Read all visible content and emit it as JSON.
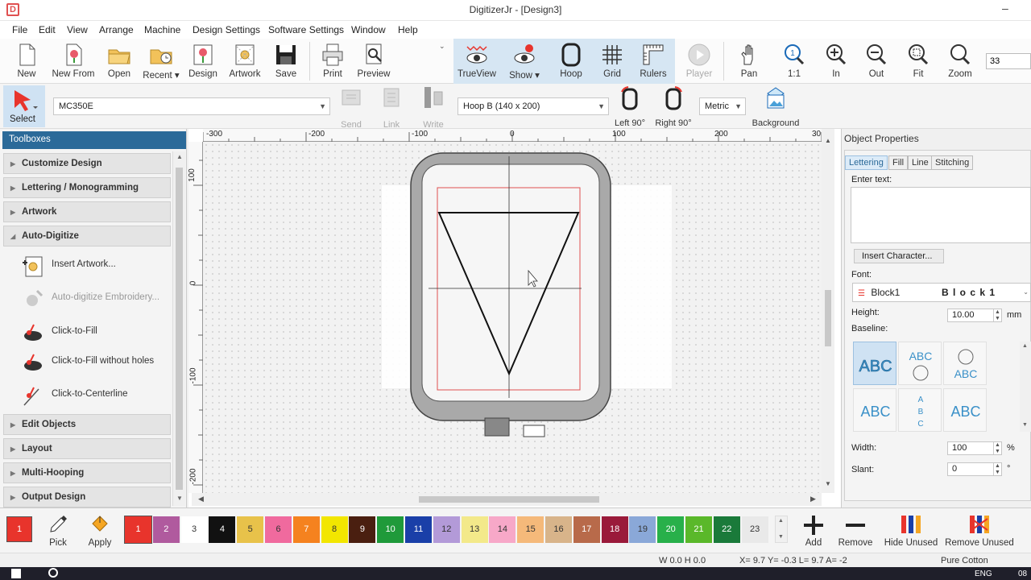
{
  "window": {
    "app_icon": "D",
    "title": "DigitizerJr - [Design3]",
    "minimize": "–"
  },
  "menu": [
    "File",
    "Edit",
    "View",
    "Arrange",
    "Machine",
    "Design Settings",
    "Software Settings",
    "Window",
    "Help"
  ],
  "toolbar1": {
    "new": "New",
    "new_from": "New From",
    "open": "Open",
    "recent": "Recent",
    "design": "Design",
    "artwork": "Artwork",
    "save": "Save",
    "print": "Print",
    "preview": "Preview",
    "trueview": "TrueView",
    "show": "Show",
    "hoop": "Hoop",
    "grid": "Grid",
    "rulers": "Rulers",
    "player": "Player",
    "pan": "Pan",
    "one_to_one": "1:1",
    "in": "In",
    "out": "Out",
    "fit": "Fit",
    "zoom": "Zoom",
    "zoom_value": "33"
  },
  "toolbar2": {
    "select": "Select",
    "machine": "MC350E",
    "send": "Send",
    "link": "Link",
    "write": "Write",
    "hoop_size": "Hoop B (140 x 200)",
    "left90": "Left 90°",
    "right90": "Right 90°",
    "units": "Metric",
    "background": "Background"
  },
  "toolboxes": {
    "header": "Toolboxes",
    "sections": {
      "customize": "Customize Design",
      "lettering": "Lettering / Monogramming",
      "artwork": "Artwork",
      "autodigitize": "Auto-Digitize",
      "edit_objects": "Edit Objects",
      "layout": "Layout",
      "multi_hooping": "Multi-Hooping",
      "output": "Output Design"
    },
    "tools": {
      "insert_artwork": "Insert Artwork...",
      "auto_embroidery": "Auto-digitize Embroidery...",
      "click_fill": "Click-to-Fill",
      "click_fill_no_holes": "Click-to-Fill without holes",
      "click_centerline": "Click-to-Centerline"
    }
  },
  "ruler": {
    "top": [
      "-300",
      "-200",
      "-100",
      "0",
      "100",
      "200",
      "30"
    ],
    "left": [
      "100",
      "0",
      "-100",
      "-200"
    ]
  },
  "object_properties": {
    "title": "Object Properties",
    "tabs": [
      "Lettering",
      "Fill",
      "Line",
      "Stitching"
    ],
    "enter_text_label": "Enter text:",
    "enter_text_value": "",
    "insert_character": "Insert Character...",
    "font_label": "Font:",
    "font_name": "Block1",
    "font_preview": "B l o c k 1",
    "height_label": "Height:",
    "height_value": "10.00",
    "height_unit": "mm",
    "baseline_label": "Baseline:",
    "baseline_text": "ABC",
    "width_label": "Width:",
    "width_value": "100",
    "width_unit": "%",
    "slant_label": "Slant:",
    "slant_value": "0",
    "slant_unit": "°"
  },
  "palette": {
    "current": "1",
    "pick": "Pick",
    "apply": "Apply",
    "add": "Add",
    "remove": "Remove",
    "hide_unused": "Hide Unused",
    "remove_unused": "Remove Unused",
    "colors": [
      {
        "n": "1",
        "c": "#e8342c"
      },
      {
        "n": "2",
        "c": "#b05a9e"
      },
      {
        "n": "3",
        "c": "#ffffff"
      },
      {
        "n": "4",
        "c": "#111111"
      },
      {
        "n": "5",
        "c": "#e8c24a"
      },
      {
        "n": "6",
        "c": "#f06a9e"
      },
      {
        "n": "7",
        "c": "#f5821f"
      },
      {
        "n": "8",
        "c": "#f2e600"
      },
      {
        "n": "9",
        "c": "#4a1f10"
      },
      {
        "n": "10",
        "c": "#1f9a3a"
      },
      {
        "n": "11",
        "c": "#1a3fa8"
      },
      {
        "n": "12",
        "c": "#b39ad8"
      },
      {
        "n": "13",
        "c": "#f3e98a"
      },
      {
        "n": "14",
        "c": "#f7a8c8"
      },
      {
        "n": "15",
        "c": "#f5b97a"
      },
      {
        "n": "16",
        "c": "#d8b48a"
      },
      {
        "n": "17",
        "c": "#b86a4a"
      },
      {
        "n": "18",
        "c": "#9a1a3a"
      },
      {
        "n": "19",
        "c": "#8aa8d8"
      },
      {
        "n": "20",
        "c": "#28b04a"
      },
      {
        "n": "21",
        "c": "#5ab82a"
      },
      {
        "n": "22",
        "c": "#1a7a3a"
      },
      {
        "n": "23",
        "c": "#e9e9e9"
      }
    ]
  },
  "status": {
    "wh": "W  0.0 H  0.0",
    "coords": "X=  9.7 Y=  -0.3 L=  9.7 A=  -2",
    "fabric": "Pure Cotton"
  },
  "taskbar": {
    "lang": "ENG",
    "time": "08"
  }
}
